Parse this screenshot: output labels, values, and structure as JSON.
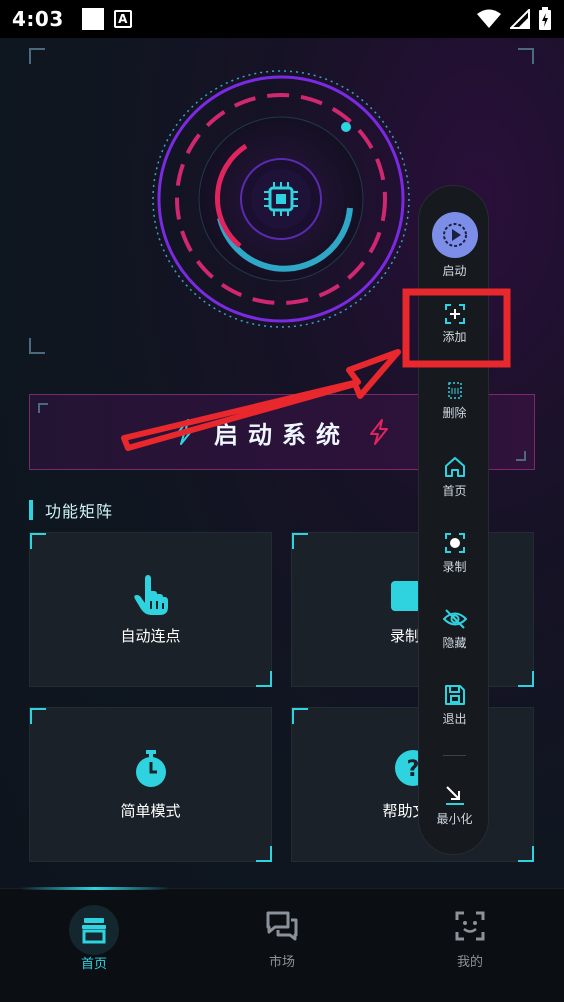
{
  "status_bar": {
    "time": "4:03",
    "a_icon": "A"
  },
  "main": {
    "start_button_label": "启动系统",
    "section_title": "功能矩阵",
    "cards": [
      {
        "label": "自动连点",
        "icon": "hand-pointer-icon"
      },
      {
        "label": "录制器",
        "icon": "video-camera-icon"
      },
      {
        "label": "简单模式",
        "icon": "stopwatch-icon"
      },
      {
        "label": "帮助文档",
        "icon": "question-icon"
      }
    ]
  },
  "floating_menu": {
    "items": [
      {
        "label": "启动",
        "icon": "play-icon"
      },
      {
        "label": "添加",
        "icon": "add-target-icon"
      },
      {
        "label": "删除",
        "icon": "delete-icon"
      },
      {
        "label": "首页",
        "icon": "home-icon"
      },
      {
        "label": "录制",
        "icon": "record-icon"
      },
      {
        "label": "隐藏",
        "icon": "eye-off-icon"
      },
      {
        "label": "退出",
        "icon": "save-icon"
      },
      {
        "label": "最小化",
        "icon": "minimize-icon"
      }
    ]
  },
  "bottom_nav": {
    "items": [
      {
        "label": "首页",
        "icon": "home-box-icon",
        "active": true
      },
      {
        "label": "市场",
        "icon": "chat-icon",
        "active": false
      },
      {
        "label": "我的",
        "icon": "face-icon",
        "active": false
      }
    ]
  },
  "colors": {
    "accent": "#2fd3e0",
    "magenta": "#e0245e",
    "purple": "#8a2be2",
    "annotation": "#e8282c"
  }
}
